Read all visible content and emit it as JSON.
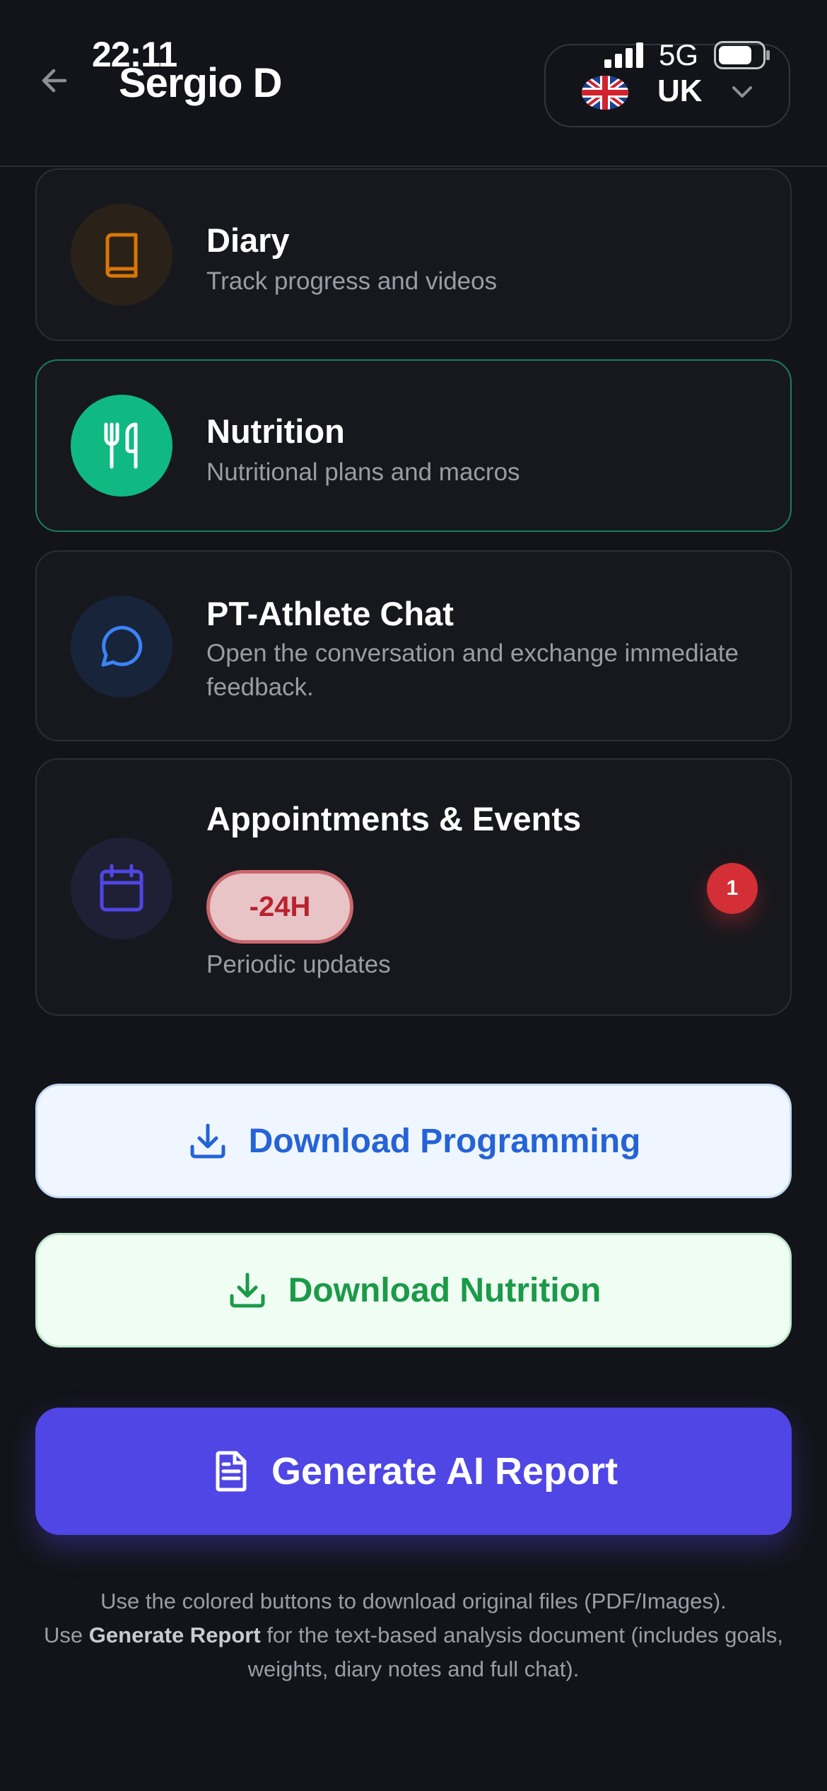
{
  "status_bar": {
    "time": "22:11",
    "network": "5G"
  },
  "header": {
    "user_name": "Sergio D",
    "language": "UK"
  },
  "cards": [
    {
      "title": "Diary",
      "subtitle": "Track progress and videos",
      "icon": "book-icon",
      "color": "#d97706"
    },
    {
      "title": "Nutrition",
      "subtitle": "Nutritional plans and macros",
      "icon": "utensils-icon",
      "color": "#10b981"
    },
    {
      "title": "PT-Athlete Chat",
      "subtitle": "Open the conversation and exchange immediate feedback.",
      "icon": "chat-bubble-icon",
      "color": "#3b82f6"
    },
    {
      "title": "Appointments & Events",
      "subtitle": "Periodic updates",
      "badge": "-24H",
      "notification_count": "1",
      "icon": "calendar-icon",
      "color": "#4f46e5"
    }
  ],
  "buttons": {
    "download_programming": "Download Programming",
    "download_nutrition": "Download Nutrition",
    "generate_ai_report": "Generate AI Report"
  },
  "footer": {
    "line1": "Use the colored buttons to download original files (PDF/Images).",
    "line2_prefix": "Use ",
    "line2_bold": "Generate Report",
    "line2_suffix": " for the text-based analysis document (includes goals, weights, diary notes and full chat)."
  }
}
